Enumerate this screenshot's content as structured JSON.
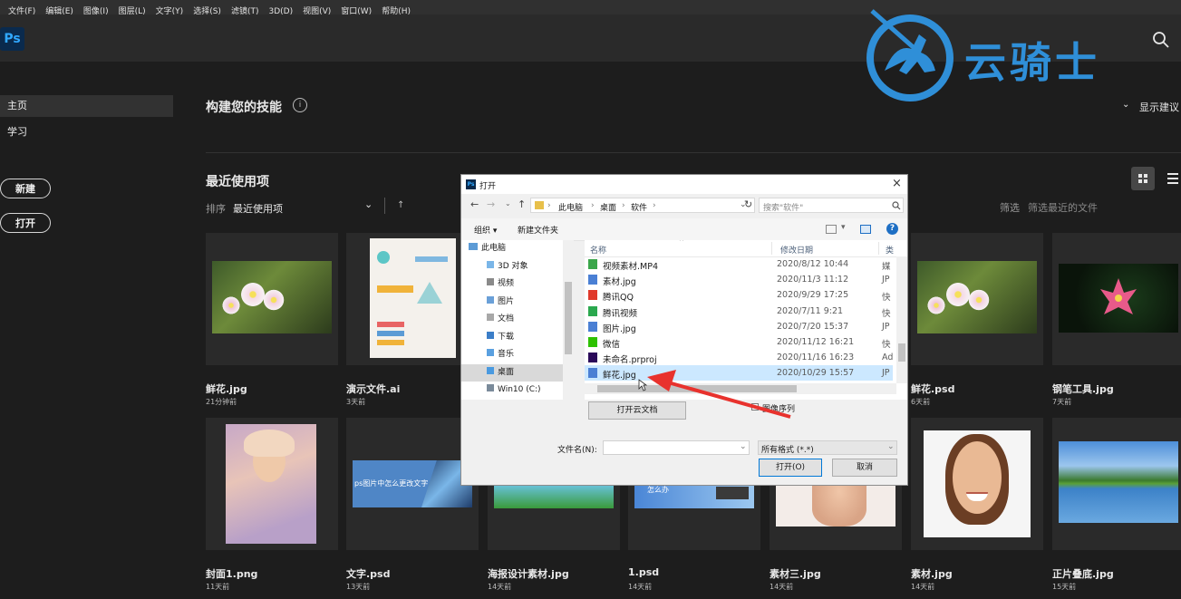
{
  "menu": [
    "文件(F)",
    "编辑(E)",
    "图像(I)",
    "图层(L)",
    "文字(Y)",
    "选择(S)",
    "滤镜(T)",
    "3D(D)",
    "视图(V)",
    "窗口(W)",
    "帮助(H)"
  ],
  "app_logo": "Ps",
  "watermark": "云骑士",
  "sidebar": {
    "items": [
      {
        "label": "主页"
      },
      {
        "label": "学习"
      }
    ],
    "new_button": "新建",
    "open_button": "打开"
  },
  "skills": {
    "title": "构建您的技能",
    "info_glyph": "i",
    "show_suggestions": "显示建议"
  },
  "recent": {
    "title": "最近使用项",
    "sort_label": "排序",
    "sort_value": "最近使用项",
    "sort_arrow": "↑",
    "filter_label": "筛选",
    "filter_placeholder": "筛选最近的文件"
  },
  "thumbs": [
    {
      "name": "鲜花.jpg",
      "time": "21分钟前"
    },
    {
      "name": "演示文件.ai",
      "time": "3天前"
    },
    {
      "name": "鲜花.psd",
      "time": "6天前"
    },
    {
      "name": "钢笔工具.jpg",
      "time": "7天前"
    },
    {
      "name": "封面1.png",
      "time": "11天前"
    },
    {
      "name": "文字.psd",
      "time": "13天前"
    },
    {
      "name": "海报设计素材.jpg",
      "time": "14天前"
    },
    {
      "name": "1.psd",
      "time": "14天前"
    },
    {
      "name": "素材三.jpg",
      "time": "14天前"
    },
    {
      "name": "素材.jpg",
      "time": "14天前"
    },
    {
      "name": "正片叠底.jpg",
      "time": "15天前"
    }
  ],
  "thumb_texts": {
    "text_psd_caption": "ps图片中怎么更改文字",
    "psd1_caption": "怎么办"
  },
  "dialog": {
    "title": "打开",
    "close": "×",
    "path": [
      "此电脑",
      "桌面",
      "软件"
    ],
    "search_placeholder": "搜索\"软件\"",
    "organize": "组织 ▾",
    "new_folder": "新建文件夹",
    "tree": [
      "此电脑",
      "3D 对象",
      "视频",
      "图片",
      "文档",
      "下载",
      "音乐",
      "桌面",
      "Win10 (C:)"
    ],
    "columns": {
      "name": "名称",
      "date": "修改日期",
      "type": "类"
    },
    "files": [
      {
        "name": "视频素材.MP4",
        "date": "2020/8/12 10:44",
        "type": "媒",
        "icon_color": "#3aa64a"
      },
      {
        "name": "素材.jpg",
        "date": "2020/11/3 11:12",
        "type": "JP",
        "icon_color": "#4a7fd4"
      },
      {
        "name": "腾讯QQ",
        "date": "2020/9/29 17:25",
        "type": "快",
        "icon_color": "#e0392b"
      },
      {
        "name": "腾讯视频",
        "date": "2020/7/11 9:21",
        "type": "快",
        "icon_color": "#2aa84e"
      },
      {
        "name": "图片.jpg",
        "date": "2020/7/20 15:37",
        "type": "JP",
        "icon_color": "#4a7fd4"
      },
      {
        "name": "微信",
        "date": "2020/11/12 16:21",
        "type": "快",
        "icon_color": "#2dc100"
      },
      {
        "name": "未命名.prproj",
        "date": "2020/11/16 16:23",
        "type": "Ad",
        "icon_color": "#2b0a5a"
      },
      {
        "name": "鲜花.jpg",
        "date": "2020/10/29 15:57",
        "type": "JP",
        "icon_color": "#4a7fd4"
      }
    ],
    "image_sequence": "图像序列",
    "cloud_button": "打开云文档",
    "filename_label": "文件名(N):",
    "filename_value": "",
    "filetype": "所有格式 (*.*)",
    "open_button": "打开(O)",
    "cancel_button": "取消"
  },
  "colors": {
    "accent": "#31a8ff",
    "watermark": "#2f8fd8",
    "arrow": "#e8322d",
    "selection": "#cce8ff"
  }
}
